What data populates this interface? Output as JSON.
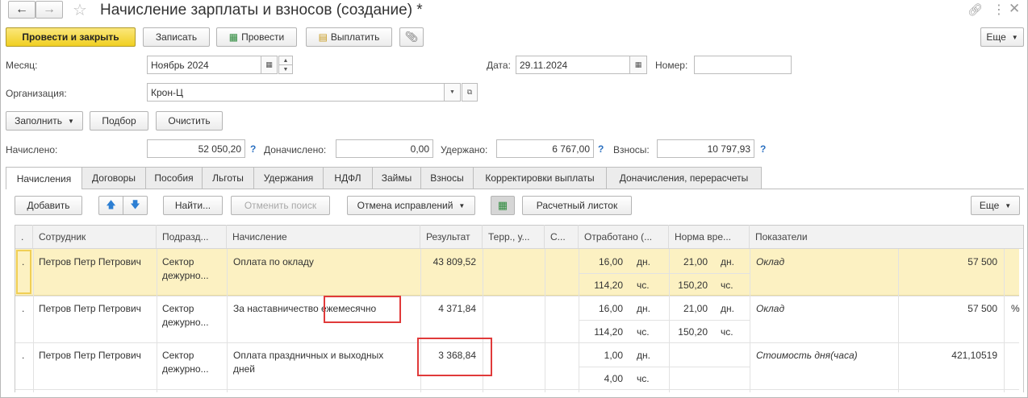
{
  "window": {
    "title": "Начисление зарплаты и взносов (создание) *"
  },
  "toolbar": {
    "post_close": "Провести и закрыть",
    "write": "Записать",
    "post": "Провести",
    "pay": "Выплатить",
    "more": "Еще"
  },
  "header": {
    "month_label": "Месяц:",
    "month_value": "Ноябрь 2024",
    "date_label": "Дата:",
    "date_value": "29.11.2024",
    "number_label": "Номер:",
    "number_value": "",
    "org_label": "Организация:",
    "org_value": "Крон-Ц"
  },
  "actions": {
    "fill": "Заполнить",
    "select": "Подбор",
    "clear": "Очистить"
  },
  "totals": {
    "accrued_label": "Начислено:",
    "accrued_value": "52 050,20",
    "additional_label": "Доначислено:",
    "additional_value": "0,00",
    "withheld_label": "Удержано:",
    "withheld_value": "6 767,00",
    "contributions_label": "Взносы:",
    "contributions_value": "10 797,93",
    "help": "?"
  },
  "tabs": [
    "Начисления",
    "Договоры",
    "Пособия",
    "Льготы",
    "Удержания",
    "НДФЛ",
    "Займы",
    "Взносы",
    "Корректировки выплаты",
    "Доначисления, перерасчеты"
  ],
  "table_toolbar": {
    "add": "Добавить",
    "find": "Найти...",
    "cancel_search": "Отменить поиск",
    "cancel_corrections": "Отмена исправлений",
    "payslip": "Расчетный листок",
    "more": "Еще"
  },
  "columns": {
    "n": ".",
    "employee": "Сотрудник",
    "division": "Подразд...",
    "accrual": "Начисление",
    "result": "Результат",
    "territory": "Терр., у...",
    "c": "С...",
    "worked": "Отработано (...",
    "norm": "Норма вре...",
    "indicators": "Показатели"
  },
  "rows": [
    {
      "n": ".",
      "employee": "Петров Петр Петрович",
      "division_1": "Сектор",
      "division_2": "дежурно...",
      "accrual_1": "Оплата по окладу",
      "accrual_2": "",
      "result": "43 809,52",
      "worked_days": "16,00",
      "days_unit": "дн.",
      "norm_days": "21,00",
      "norm_days_unit": "дн.",
      "worked_hours": "114,20",
      "hours_unit": "чс.",
      "norm_hours": "150,20",
      "norm_hours_unit": "чс.",
      "indicator": "Оклад",
      "indicator_value": "57 500",
      "extra": ""
    },
    {
      "n": ".",
      "employee": "Петров Петр Петрович",
      "division_1": "Сектор",
      "division_2": "дежурно...",
      "accrual_1": "За наставничество ежемесячно",
      "accrual_2": "",
      "result": "4 371,84",
      "worked_days": "16,00",
      "days_unit": "дн.",
      "norm_days": "21,00",
      "norm_days_unit": "дн.",
      "worked_hours": "114,20",
      "hours_unit": "чс.",
      "norm_hours": "150,20",
      "norm_hours_unit": "чс.",
      "indicator": "Оклад",
      "indicator_value": "57 500",
      "extra": "%"
    },
    {
      "n": ".",
      "employee": "Петров Петр Петрович",
      "division_1": "Сектор",
      "division_2": "дежурно...",
      "accrual_1": "Оплата праздничных и выходных",
      "accrual_2": "дней",
      "result": "3 368,84",
      "worked_days": "1,00",
      "days_unit": "дн.",
      "norm_days": "",
      "norm_days_unit": "",
      "worked_hours": "4,00",
      "hours_unit": "чс.",
      "norm_hours": "",
      "norm_hours_unit": "",
      "indicator": "Стоимость дня(часа)",
      "indicator_value": "421,10519",
      "extra": ""
    }
  ]
}
